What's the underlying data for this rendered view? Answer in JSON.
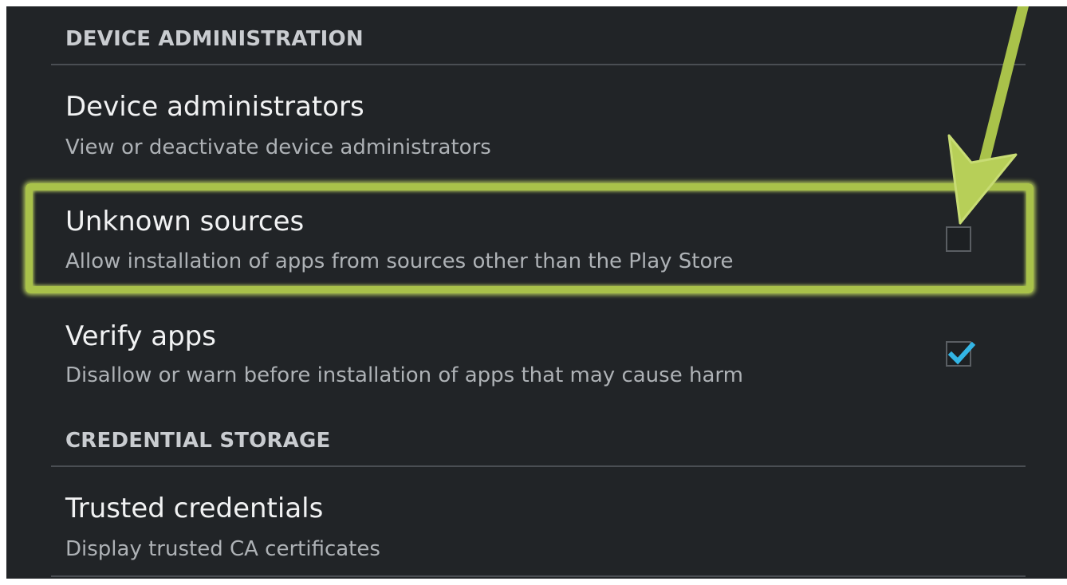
{
  "sections": [
    {
      "header": "DEVICE ADMINISTRATION",
      "items": [
        {
          "title": "Device administrators",
          "summary": "View or deactivate device administrators"
        },
        {
          "title": "Unknown sources",
          "summary": "Allow installation of apps from sources other than the Play Store",
          "checked": false
        },
        {
          "title": "Verify apps",
          "summary": "Disallow or warn before installation of apps that may cause harm",
          "checked": true
        }
      ]
    },
    {
      "header": "CREDENTIAL STORAGE",
      "items": [
        {
          "title": "Trusted credentials",
          "summary": "Display trusted CA certificates"
        }
      ]
    }
  ],
  "colors": {
    "background": "#212427",
    "highlight": "#a9c24a",
    "checkmark": "#33b5e5"
  },
  "icons": {
    "annotation_arrow": "arrow-down-left-icon",
    "check": "checkmark-icon"
  }
}
